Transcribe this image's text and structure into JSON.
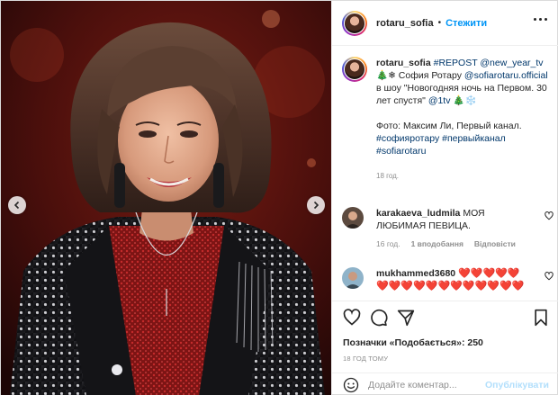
{
  "colors": {
    "link": "#00376b",
    "follow_blue": "#0095f6",
    "muted": "#8e8e8e",
    "heart_red": "#ed4956",
    "post_disabled": "#b2dffc"
  },
  "header": {
    "username": "rotaru_sofia",
    "separator": "•",
    "follow_label": "Стежити",
    "more_icon": "more-horizontal-icon"
  },
  "caption": {
    "username": "rotaru_sofia",
    "repost_tag": "#REPOST",
    "repost_user": "@new_year_tv",
    "emoji_tree_snow": "🎄❄",
    "name_text": "София Ротару",
    "official_mention": "@sofiarotaru.official",
    "show_text": "в шоу \"Новогодняя ночь на Первом. 30 лет спустя\"",
    "channel_mention": "@1tv",
    "emoji_end": "🎄❄️",
    "photo_credit": "Фото: Максим Ли, Первый канал.",
    "hashtags": [
      "#софияротару",
      "#первыйканал",
      "#sofiarotaru"
    ],
    "time": "18 год."
  },
  "comments": [
    {
      "username": "karakaeva_ludmila",
      "text": "МОЯ ЛЮБИМАЯ ПЕВИЦА.",
      "time": "16 год.",
      "replies": "1 вподобання",
      "reply_label": "Відповісти"
    },
    {
      "username": "mukhammed3680",
      "hearts_line1": "❤️❤️❤️❤️❤️",
      "hearts_line2": "❤️❤️❤️❤️❤️❤️❤️❤️❤️❤️❤️❤️"
    }
  ],
  "likes": {
    "label": "Позначки «Подобається»:",
    "count": "250"
  },
  "post_time": "18 ГОД ТОМУ",
  "add_comment": {
    "placeholder": "Додайте коментар...",
    "post_label": "Опублікувати"
  },
  "icons": [
    "heart-icon",
    "comment-icon",
    "share-icon",
    "bookmark-icon",
    "emoji-icon",
    "chevron-left-icon",
    "chevron-right-icon"
  ]
}
